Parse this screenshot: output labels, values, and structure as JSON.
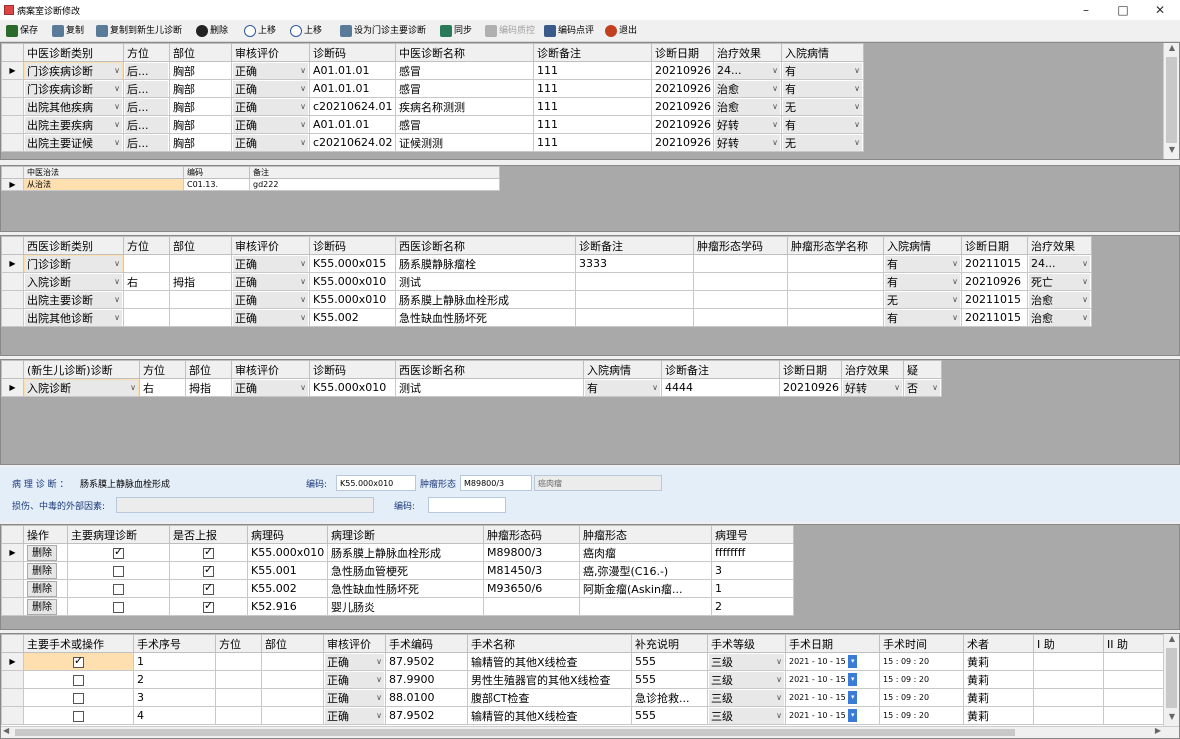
{
  "window": {
    "title": "病案室诊断修改",
    "min": "–",
    "max": "□",
    "close": "✕"
  },
  "toolbar": {
    "save": "保存",
    "copy": "复制",
    "copy_newborn": "复制到新生儿诊断",
    "delete": "删除",
    "move_up": "上移",
    "move_down": "上移",
    "set_main": "设为门诊主要诊断",
    "sync": "同步",
    "code_qc": "编码质控",
    "code_review": "编码点评",
    "exit": "退出"
  },
  "tcm_diag": {
    "headers": [
      "中医诊断类别",
      "方位",
      "部位",
      "审核评价",
      "诊断码",
      "中医诊断名称",
      "诊断备注",
      "诊断日期",
      "治疗效果",
      "入院病情"
    ],
    "rows": [
      {
        "type": "门诊疾病诊断",
        "pos": "后...",
        "part": "胸部",
        "eval": "正确",
        "code": "A01.01.01",
        "name": "感冒",
        "note": "111",
        "date": "20210926",
        "effect": "24...",
        "cond": "有"
      },
      {
        "type": "门诊疾病诊断",
        "pos": "后...",
        "part": "胸部",
        "eval": "正确",
        "code": "A01.01.01",
        "name": "感冒",
        "note": "111",
        "date": "20210926",
        "effect": "治愈",
        "cond": "有"
      },
      {
        "type": "出院其他疾病",
        "pos": "后...",
        "part": "胸部",
        "eval": "正确",
        "code": "c20210624.01",
        "name": "疾病名称测测",
        "note": "111",
        "date": "20210926",
        "effect": "治愈",
        "cond": "无"
      },
      {
        "type": "出院主要疾病",
        "pos": "后...",
        "part": "胸部",
        "eval": "正确",
        "code": "A01.01.01",
        "name": "感冒",
        "note": "111",
        "date": "20210926",
        "effect": "好转",
        "cond": "有"
      },
      {
        "type": "出院主要证候",
        "pos": "后...",
        "part": "胸部",
        "eval": "正确",
        "code": "c20210624.02",
        "name": "证候测测",
        "note": "111",
        "date": "20210926",
        "effect": "好转",
        "cond": "无"
      }
    ]
  },
  "tcm_treat": {
    "headers": [
      "中医治法",
      "编码",
      "备注"
    ],
    "rows": [
      {
        "name": "从治法",
        "code": "C01.13.",
        "note": "gd222"
      }
    ]
  },
  "wm_diag": {
    "headers": [
      "西医诊断类别",
      "方位",
      "部位",
      "审核评价",
      "诊断码",
      "西医诊断名称",
      "诊断备注",
      "肿瘤形态学码",
      "肿瘤形态学名称",
      "入院病情",
      "诊断日期",
      "治疗效果"
    ],
    "rows": [
      {
        "type": "门诊诊断",
        "pos": "",
        "part": "",
        "eval": "正确",
        "code": "K55.000x015",
        "name": "肠系膜静脉瘤栓",
        "note": "3333",
        "mcode": "",
        "mname": "",
        "cond": "有",
        "date": "20211015",
        "effect": "24..."
      },
      {
        "type": "入院诊断",
        "pos": "右",
        "part": "拇指",
        "eval": "正确",
        "code": "K55.000x010",
        "name": "测试",
        "note": "",
        "mcode": "",
        "mname": "",
        "cond": "有",
        "date": "20210926",
        "effect": "死亡"
      },
      {
        "type": "出院主要诊断",
        "pos": "",
        "part": "",
        "eval": "正确",
        "code": "K55.000x010",
        "name": "肠系膜上静脉血栓形成",
        "note": "",
        "mcode": "",
        "mname": "",
        "cond": "无",
        "date": "20211015",
        "effect": "治愈"
      },
      {
        "type": "出院其他诊断",
        "pos": "",
        "part": "",
        "eval": "正确",
        "code": "K55.002",
        "name": "急性缺血性肠坏死",
        "note": "",
        "mcode": "",
        "mname": "",
        "cond": "有",
        "date": "20211015",
        "effect": "治愈"
      }
    ]
  },
  "nb_diag": {
    "headers": [
      "(新生儿诊断)诊断",
      "方位",
      "部位",
      "审核评价",
      "诊断码",
      "西医诊断名称",
      "入院病情",
      "诊断备注",
      "诊断日期",
      "治疗效果",
      "疑"
    ],
    "rows": [
      {
        "type": "入院诊断",
        "pos": "右",
        "part": "拇指",
        "eval": "正确",
        "code": "K55.000x010",
        "name": "测试",
        "cond": "有",
        "note": "4444",
        "date": "20210926",
        "effect": "好转",
        "doubt": "否"
      }
    ]
  },
  "pathology_panel": {
    "diag_label": "病 理 诊 断 ：",
    "diag_value": "肠系膜上静脉血栓形成",
    "code_label": "编码:",
    "code_value": "K55.000x010",
    "tumor_label": "肿瘤形态",
    "tumor_code": "M89800/3",
    "tumor_name": "癌肉瘤",
    "injury_label": "损伤、中毒的外部因素:",
    "injury_value": "",
    "code2_label": "编码:",
    "code2_value": ""
  },
  "pathology": {
    "headers": [
      "操作",
      "主要病理诊断",
      "是否上报",
      "病理码",
      "病理诊断",
      "肿瘤形态码",
      "肿瘤形态",
      "病理号"
    ],
    "rows": [
      {
        "op": "删除",
        "main": true,
        "report": true,
        "code": "K55.000x010",
        "name": "肠系膜上静脉血栓形成",
        "mcode": "M89800/3",
        "mname": "癌肉瘤",
        "no": "ffffffff"
      },
      {
        "op": "删除",
        "main": false,
        "report": true,
        "code": "K55.001",
        "name": "急性肠血管梗死",
        "mcode": "M81450/3",
        "mname": "癌,弥漫型(C16.-)",
        "no": "3"
      },
      {
        "op": "删除",
        "main": false,
        "report": true,
        "code": "K55.002",
        "name": "急性缺血性肠坏死",
        "mcode": "M93650/6",
        "mname": "阿斯金瘤(Askin瘤...",
        "no": "1"
      },
      {
        "op": "删除",
        "main": false,
        "report": true,
        "code": "K52.916",
        "name": "婴儿肠炎",
        "mcode": "",
        "mname": "",
        "no": "2"
      }
    ]
  },
  "surgery": {
    "headers": [
      "主要手术或操作",
      "手术序号",
      "方位",
      "部位",
      "审核评价",
      "手术编码",
      "手术名称",
      "补充说明",
      "手术等级",
      "手术日期",
      "手术时间",
      "术者",
      "I 助",
      "II 助"
    ],
    "rows": [
      {
        "main": true,
        "seq": "1",
        "pos": "",
        "part": "",
        "eval": "正确",
        "code": "87.9502",
        "name": "输精管的其他X线检查",
        "note": "555",
        "level": "三级",
        "date": "2021 - 10 - 15",
        "time": "15 : 09 : 20",
        "surgeon": "黄莉",
        "a1": "",
        "a2": ""
      },
      {
        "main": false,
        "seq": "2",
        "pos": "",
        "part": "",
        "eval": "正确",
        "code": "87.9900",
        "name": "男性生殖器官的其他X线检查",
        "note": "555",
        "level": "三级",
        "date": "2021 - 10 - 15",
        "time": "15 : 09 : 20",
        "surgeon": "黄莉",
        "a1": "",
        "a2": ""
      },
      {
        "main": false,
        "seq": "3",
        "pos": "",
        "part": "",
        "eval": "正确",
        "code": "88.0100",
        "name": "腹部CT检查",
        "note": "急诊抢救...",
        "level": "三级",
        "date": "2021 - 10 - 15",
        "time": "15 : 09 : 20",
        "surgeon": "黄莉",
        "a1": "",
        "a2": ""
      },
      {
        "main": false,
        "seq": "4",
        "pos": "",
        "part": "",
        "eval": "正确",
        "code": "87.9502",
        "name": "输精管的其他X线检查",
        "note": "555",
        "level": "三级",
        "date": "2021 - 10 - 15",
        "time": "15 : 09 : 20",
        "surgeon": "黄莉",
        "a1": "",
        "a2": ""
      }
    ]
  },
  "colors": {
    "selected_row": "#fddfb0",
    "panel_bg": "#e4eef9",
    "grid_bg": "#a9a9a9"
  }
}
